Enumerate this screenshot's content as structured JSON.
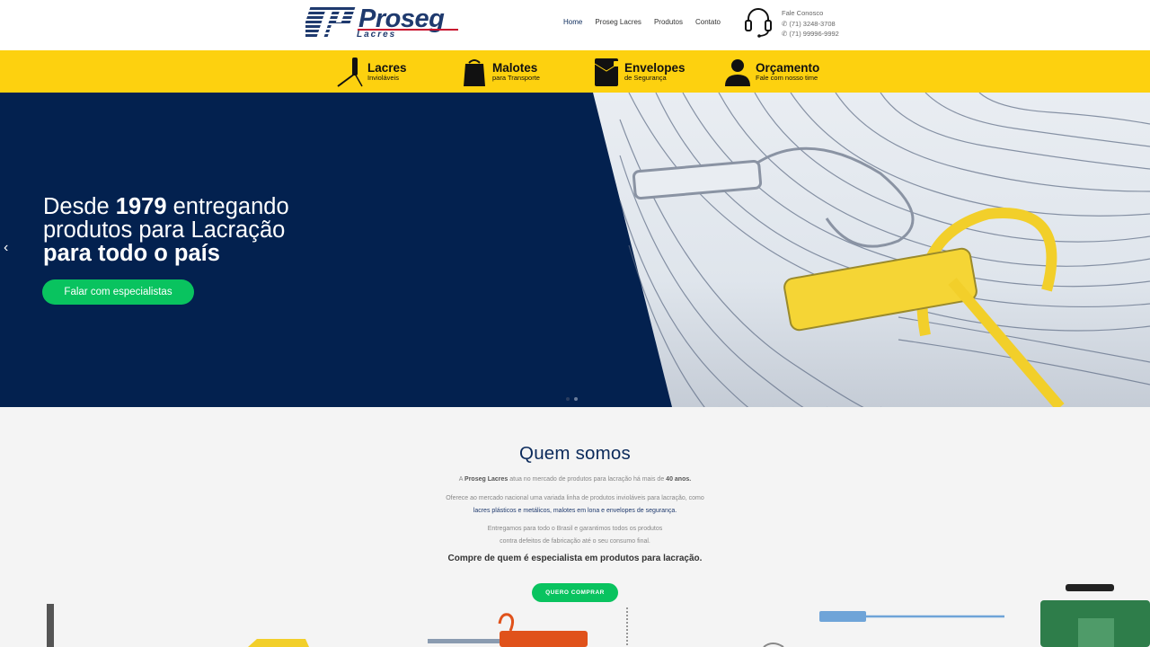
{
  "brand": {
    "name": "Proseg",
    "sub": "Lacres"
  },
  "nav": {
    "items": [
      "Home",
      "Proseg Lacres",
      "Produtos",
      "Contato"
    ]
  },
  "contact": {
    "heading": "Fale Conosco",
    "phone": "(71) 3248-3708",
    "whatsapp": "(71) 99996-9992"
  },
  "categories": [
    {
      "title": "Lacres",
      "subtitle": "Invioláveis",
      "icon": "seal-icon"
    },
    {
      "title": "Malotes",
      "subtitle": "para Transporte",
      "icon": "bag-icon"
    },
    {
      "title": "Envelopes",
      "subtitle": "de Segurança",
      "icon": "envelope-icon"
    },
    {
      "title": "Orçamento",
      "subtitle": "Fale com nosso time",
      "icon": "person-icon"
    }
  ],
  "hero": {
    "line1_pre": "Desde ",
    "line1_year": "1979",
    "line1_post": " entregando",
    "line2": "produtos para Lacração",
    "line3": "para todo o país",
    "cta": "Falar com especialistas"
  },
  "about": {
    "title": "Quem somos",
    "p1_pre": "A ",
    "p1_brand": "Proseg Lacres",
    "p1_mid": " atua no mercado de produtos para lacração há mais de ",
    "p1_years": "40 anos.",
    "p2_line1": "Oferece ao mercado nacional uma variada linha de produtos invioláveis para lacração, como",
    "p2_line2": "lacres plásticos e metálicos, malotes em lona e envelopes de segurança.",
    "p3_line1": "Entregamos para todo o Brasil e garantimos todos os produtos",
    "p3_line2": "contra defeitos de fabricação até o seu consumo final.",
    "strong": "Compre de quem é especialista em produtos para lacração.",
    "button": "QUERO COMPRAR"
  },
  "colors": {
    "navy": "#03214f",
    "yellow": "#fdd10f",
    "green": "#09c35f",
    "brand_blue": "#1f3a6e"
  }
}
